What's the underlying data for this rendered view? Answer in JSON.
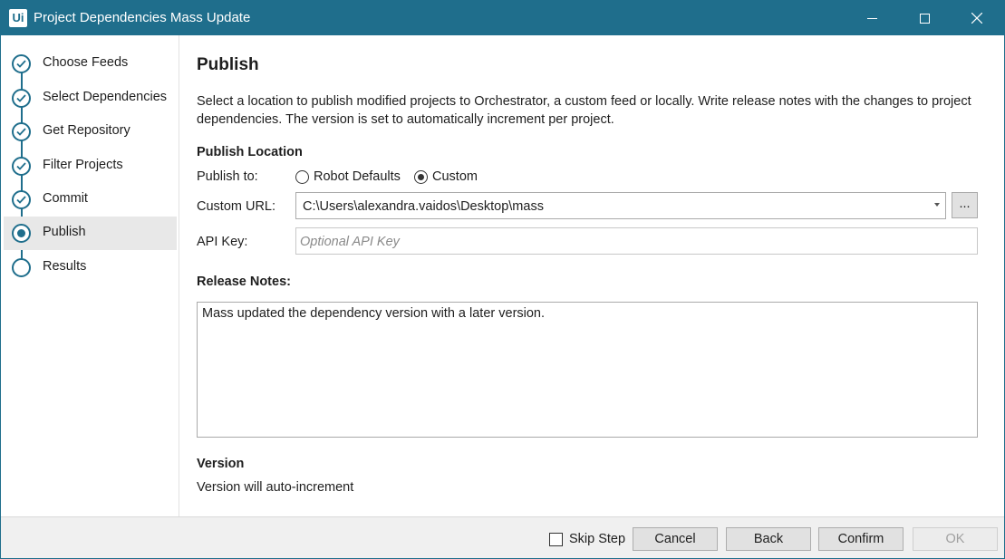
{
  "window": {
    "title": "Project Dependencies Mass Update",
    "logo_text": "Ui"
  },
  "sidebar": {
    "steps": [
      {
        "label": "Choose Feeds",
        "state": "done"
      },
      {
        "label": "Select Dependencies",
        "state": "done"
      },
      {
        "label": "Get Repository",
        "state": "done"
      },
      {
        "label": "Filter Projects",
        "state": "done"
      },
      {
        "label": "Commit",
        "state": "done"
      },
      {
        "label": "Publish",
        "state": "current"
      },
      {
        "label": "Results",
        "state": "pending"
      }
    ]
  },
  "main": {
    "title": "Publish",
    "description": "Select a location to publish modified projects to Orchestrator, a custom feed or locally. Write release notes with the changes to project dependencies. The version is set to automatically increment per project.",
    "publish_location": {
      "heading": "Publish Location",
      "publish_to_label": "Publish to:",
      "options": [
        {
          "label": "Robot Defaults",
          "selected": false
        },
        {
          "label": "Custom",
          "selected": true
        }
      ],
      "custom_url_label": "Custom URL:",
      "custom_url_value": "C:\\Users\\alexandra.vaidos\\Desktop\\mass",
      "browse_label": "...",
      "api_key_label": "API Key:",
      "api_key_placeholder": "Optional API Key"
    },
    "release_notes": {
      "heading": "Release Notes:",
      "value": "Mass updated the dependency version with a later version."
    },
    "version": {
      "heading": "Version",
      "text": "Version will auto-increment"
    }
  },
  "footer": {
    "skip_step_label": "Skip Step",
    "skip_step_checked": false,
    "cancel_label": "Cancel",
    "back_label": "Back",
    "confirm_label": "Confirm",
    "ok_label": "OK"
  },
  "colors": {
    "accent": "#1f6e8c"
  }
}
